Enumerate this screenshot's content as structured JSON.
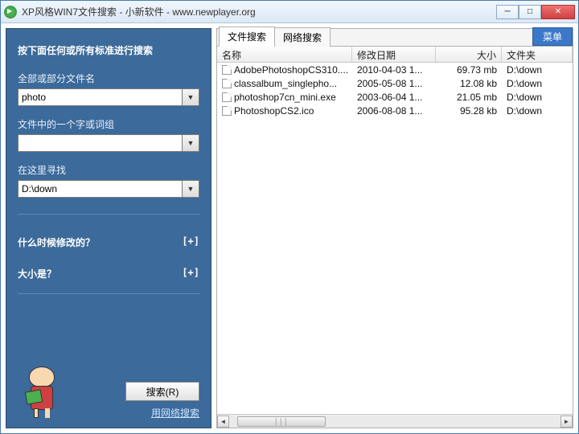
{
  "window": {
    "title": "XP风格WIN7文件搜索 - 小新软件 - www.newplayer.org"
  },
  "sidebar": {
    "heading": "按下面任何或所有标准进行搜索",
    "filename_label": "全部或部分文件名",
    "filename_value": "photo",
    "content_label": "文件中的一个字或词组",
    "content_value": "",
    "lookin_label": "在这里寻找",
    "lookin_value": "D:\\down",
    "when_label": "什么时候修改的？",
    "size_label": "大小是？",
    "expand_symbol": "[+]",
    "search_button": "搜索(R)",
    "net_link": "用网络搜索"
  },
  "tabs": {
    "file_search": "文件搜索",
    "net_search": "网络搜索",
    "menu": "菜单"
  },
  "columns": {
    "name": "名称",
    "date": "修改日期",
    "size": "大小",
    "folder": "文件夹"
  },
  "results": [
    {
      "name": "AdobePhotoshopCS310....",
      "date": "2010-04-03 1...",
      "size": "69.73 mb",
      "folder": "D:\\down"
    },
    {
      "name": "classalbum_singlepho...",
      "date": "2005-05-08 1...",
      "size": "12.08 kb",
      "folder": "D:\\down"
    },
    {
      "name": "photoshop7cn_mini.exe",
      "date": "2003-06-04 1...",
      "size": "21.05 mb",
      "folder": "D:\\down"
    },
    {
      "name": "PhotoshopCS2.ico",
      "date": "2006-08-08 1...",
      "size": "95.28 kb",
      "folder": "D:\\down"
    }
  ]
}
